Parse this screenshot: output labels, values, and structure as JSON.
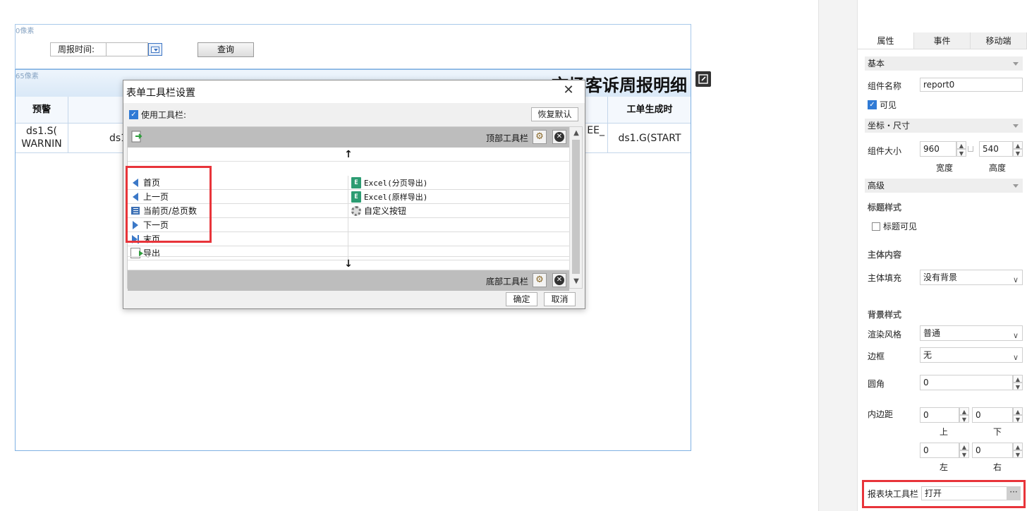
{
  "canvas": {
    "param_pixel_label": "0像素",
    "report_pixel_label": "65像素",
    "param_label": "周报时间:",
    "query_button": "查询",
    "report_title": "市场客诉周报明细",
    "columns": [
      "预警",
      "",
      "EE_",
      "工单生成时"
    ],
    "column_headers_visible": {
      "warning": "预警",
      "order_time": "工单生成时"
    },
    "row_cells": {
      "c1": "ds1.S(\nWARNIN",
      "c2": "ds1",
      "c3": "EE_",
      "c4": "ds1.G(START"
    }
  },
  "dialog": {
    "title": "表单工具栏设置",
    "use_toolbar_label": "使用工具栏:",
    "reset_button": "恢复默认",
    "top_toolbar_label": "顶部工具栏",
    "bottom_toolbar_label": "底部工具栏",
    "arrow_up": "↑",
    "arrow_down": "↓",
    "left_items": [
      "首页",
      "上一页",
      "当前页/总页数",
      "下一页",
      "末页",
      "导出"
    ],
    "right_items": [
      "Excel(分页导出)",
      "Excel(原样导出)",
      "自定义按钮"
    ],
    "ok_button": "确定",
    "cancel_button": "取消"
  },
  "panel": {
    "tabs": [
      "属性",
      "事件",
      "移动端"
    ],
    "active_tab": "属性",
    "sections": {
      "basic": "基本",
      "coords": "坐标・尺寸",
      "advanced": "高级"
    },
    "component_name_label": "组件名称",
    "component_name_value": "report0",
    "visible_label": "可见",
    "size_label": "组件大小",
    "width_value": "960",
    "height_value": "540",
    "width_caption": "宽度",
    "height_caption": "高度",
    "title_style_label": "标题样式",
    "title_visible_label": "标题可见",
    "body_content_label": "主体内容",
    "body_fill_label": "主体填充",
    "body_fill_value": "没有背景",
    "bg_style_label": "背景样式",
    "render_style_label": "渲染风格",
    "render_style_value": "普通",
    "border_label": "边框",
    "border_value": "无",
    "radius_label": "圆角",
    "radius_value": "0",
    "padding_label": "内边距",
    "pad_top": "0",
    "pad_bottom": "0",
    "pad_left": "0",
    "pad_right": "0",
    "pad_top_caption": "上",
    "pad_bottom_caption": "下",
    "pad_left_caption": "左",
    "pad_right_caption": "右",
    "report_toolbar_label": "报表块工具栏",
    "report_toolbar_value": "打开",
    "more_button": "···"
  },
  "colors": {
    "accent": "#2f7ad5",
    "highlight": "#e8343a"
  }
}
